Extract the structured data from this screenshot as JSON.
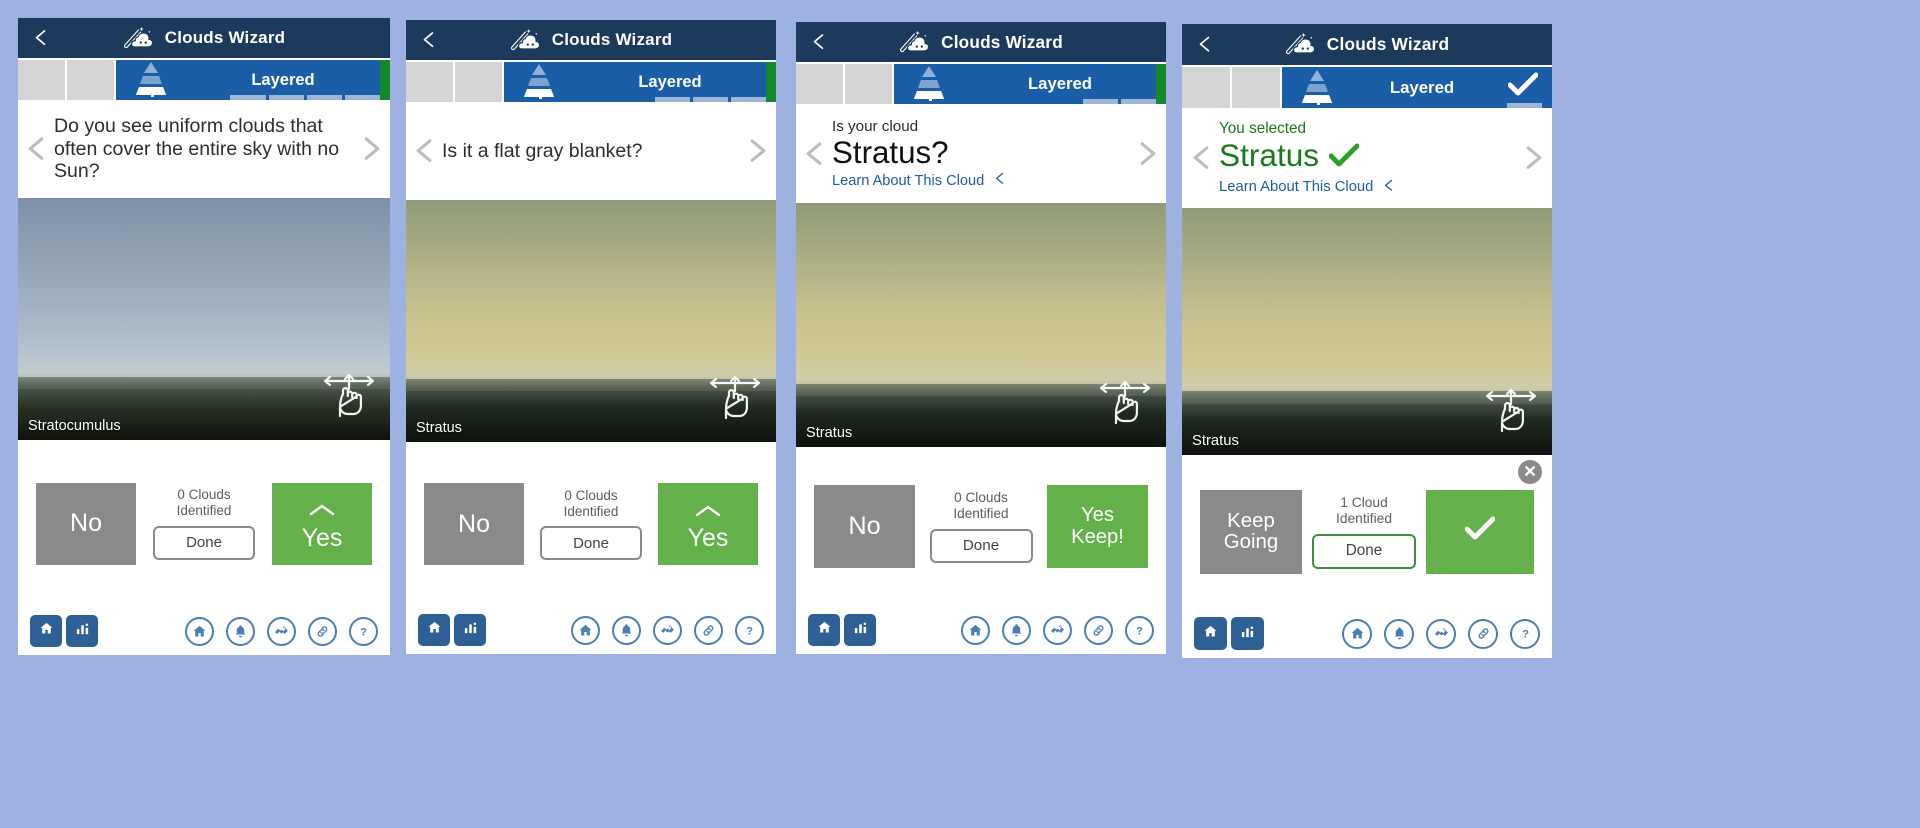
{
  "app": {
    "title": "Clouds Wizard",
    "back_icon": "chevron-left-icon",
    "wizard_icon": "cloud-wand-icon",
    "header_bg": "#1b3a5c",
    "accent_blue": "#1b5ea8",
    "accent_green": "#64b04a",
    "green_dark": "#14892c"
  },
  "tab": {
    "label": "Layered",
    "icon": "layered-cloud-triangle-icon",
    "check_icon": "check-icon",
    "arrow_icon": "tab-arrow-icon"
  },
  "panels": [
    {
      "id": "panel-question-uniform",
      "progress": {
        "total": 7,
        "filled": 3
      },
      "tab_state": "arrow",
      "question_mode": "question",
      "question": "Do you see uniform clouds that often cover the entire sky with no Sun?",
      "prev_icon": "chevron-left-icon",
      "next_icon": "chevron-right-icon",
      "photo": {
        "caption": "Stratocumulus",
        "sky_top": "#7e90a4",
        "sky_mid": "#9fb0c0",
        "sky_bottom": "#c3ced8",
        "ground": "#2a3526",
        "drag_icon": "drag-hand-icon"
      },
      "left_button": {
        "label": "No",
        "style": "grey"
      },
      "right_button": {
        "label": "Yes",
        "style": "green",
        "caret_icon": "caret-up-icon"
      },
      "counter": "0 Clouds Identified",
      "done_label": "Done",
      "done_style": "grey",
      "show_close": false
    },
    {
      "id": "panel-question-blanket",
      "progress": {
        "total": 7,
        "filled": 4
      },
      "tab_state": "arrow",
      "question_mode": "question",
      "question": "Is it a flat gray blanket?",
      "prev_icon": "chevron-left-icon",
      "next_icon": "chevron-right-icon",
      "photo": {
        "caption": "Stratus",
        "sky_top": "#8f9a78",
        "sky_mid": "#c6bf8e",
        "sky_bottom": "#d9cf9a",
        "ground": "#1f2a20",
        "drag_icon": "drag-hand-icon"
      },
      "left_button": {
        "label": "No",
        "style": "grey"
      },
      "right_button": {
        "label": "Yes",
        "style": "green",
        "caret_icon": "caret-up-icon"
      },
      "counter": "0 Clouds Identified",
      "done_label": "Done",
      "done_style": "grey",
      "show_close": false
    },
    {
      "id": "panel-confirm-stratus",
      "progress": {
        "total": 7,
        "filled": 5
      },
      "tab_state": "arrow",
      "question_mode": "result",
      "pre_label": "Is your cloud",
      "answer": "Stratus?",
      "answer_color": "dark",
      "learn_label": "Learn About This Cloud",
      "learn_chevron": "chevron-left-icon",
      "show_inline_check": false,
      "prev_icon": "chevron-left-icon",
      "next_icon": "chevron-right-icon",
      "photo": {
        "caption": "Stratus",
        "sky_top": "#8f9a78",
        "sky_mid": "#c6bf8e",
        "sky_bottom": "#d9cf9a",
        "ground": "#1f2a20",
        "drag_icon": "drag-hand-icon"
      },
      "left_button": {
        "label": "No",
        "style": "grey"
      },
      "right_button": {
        "label": "Yes Keep!",
        "style": "green"
      },
      "counter": "0 Clouds Identified",
      "done_label": "Done",
      "done_style": "grey",
      "show_close": false
    },
    {
      "id": "panel-selected-stratus",
      "progress": {
        "total": 7,
        "filled": 6
      },
      "tab_state": "check",
      "question_mode": "result",
      "pre_label": "You selected",
      "answer": "Stratus",
      "answer_color": "green",
      "learn_label": "Learn About This Cloud",
      "learn_chevron": "chevron-left-icon",
      "show_inline_check": true,
      "prev_icon": "chevron-left-icon",
      "next_icon": "chevron-right-icon",
      "photo": {
        "caption": "Stratus",
        "sky_top": "#8f9a78",
        "sky_mid": "#c6bf8e",
        "sky_bottom": "#d9cf9a",
        "ground": "#1f2a20",
        "drag_icon": "drag-hand-icon"
      },
      "left_button": {
        "label": "Keep Going",
        "style": "grey"
      },
      "right_button": {
        "label": "",
        "style": "green",
        "check_icon": "check-icon"
      },
      "counter": "1 Cloud Identified",
      "done_label": "Done",
      "done_style": "green",
      "show_close": true,
      "close_icon": "close-x-icon"
    }
  ],
  "bottom_nav": {
    "left": [
      {
        "icon": "home-icon",
        "name": "home-square-button"
      },
      {
        "icon": "chart-icon",
        "name": "data-square-button"
      }
    ],
    "right": [
      {
        "icon": "home-icon",
        "name": "nav-home-button"
      },
      {
        "icon": "bell-icon",
        "name": "nav-notifications-button"
      },
      {
        "icon": "satellite-icon",
        "name": "nav-satellite-button"
      },
      {
        "icon": "link-icon",
        "name": "nav-link-button"
      },
      {
        "icon": "question-icon",
        "name": "nav-help-button"
      }
    ]
  }
}
